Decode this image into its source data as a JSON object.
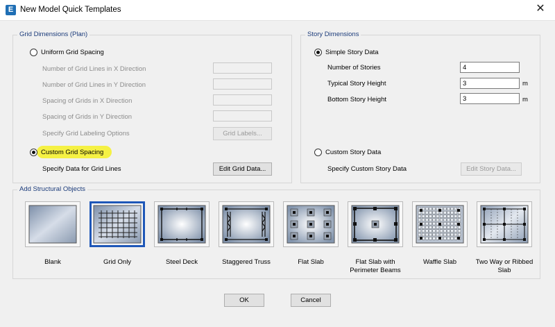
{
  "window": {
    "title": "New Model Quick Templates",
    "app_icon_letter": "E"
  },
  "grid_dimensions": {
    "title": "Grid Dimensions (Plan)",
    "uniform_label": "Uniform Grid Spacing",
    "uniform_rows": [
      "Number of Grid Lines in X Direction",
      "Number of Grid Lines in Y Direction",
      "Spacing of Grids in X Direction",
      "Spacing of Grids in Y Direction",
      "Specify Grid Labeling Options"
    ],
    "grid_labels_button": "Grid Labels...",
    "custom_label": "Custom Grid Spacing",
    "custom_row_label": "Specify Data for Grid Lines",
    "edit_grid_button": "Edit Grid Data...",
    "selected": "custom"
  },
  "story_dimensions": {
    "title": "Story Dimensions",
    "simple_label": "Simple Story Data",
    "number_of_stories_label": "Number of Stories",
    "number_of_stories": "4",
    "typical_height_label": "Typical Story Height",
    "typical_height": "3",
    "bottom_height_label": "Bottom Story Height",
    "bottom_height": "3",
    "unit": "m",
    "custom_label": "Custom Story Data",
    "custom_row_label": "Specify Custom Story Data",
    "edit_story_button": "Edit Story Data...",
    "selected": "simple"
  },
  "structural_objects": {
    "title": "Add Structural Objects",
    "items": [
      {
        "label": "Blank",
        "icon": "blank-template-icon"
      },
      {
        "label": "Grid Only",
        "icon": "grid-only-icon"
      },
      {
        "label": "Steel Deck",
        "icon": "steel-deck-icon"
      },
      {
        "label": "Staggered Truss",
        "icon": "staggered-truss-icon"
      },
      {
        "label": "Flat Slab",
        "icon": "flat-slab-icon"
      },
      {
        "label": "Flat Slab with Perimeter Beams",
        "icon": "flat-slab-perimeter-beams-icon"
      },
      {
        "label": "Waffle Slab",
        "icon": "waffle-slab-icon"
      },
      {
        "label": "Two Way or Ribbed Slab",
        "icon": "two-way-ribbed-slab-icon"
      }
    ],
    "selected_index": 1
  },
  "buttons": {
    "ok": "OK",
    "cancel": "Cancel"
  },
  "colors": {
    "highlight": "#f4f03a",
    "group_title": "#1b3b7a",
    "selection_border": "#1e57b8"
  }
}
